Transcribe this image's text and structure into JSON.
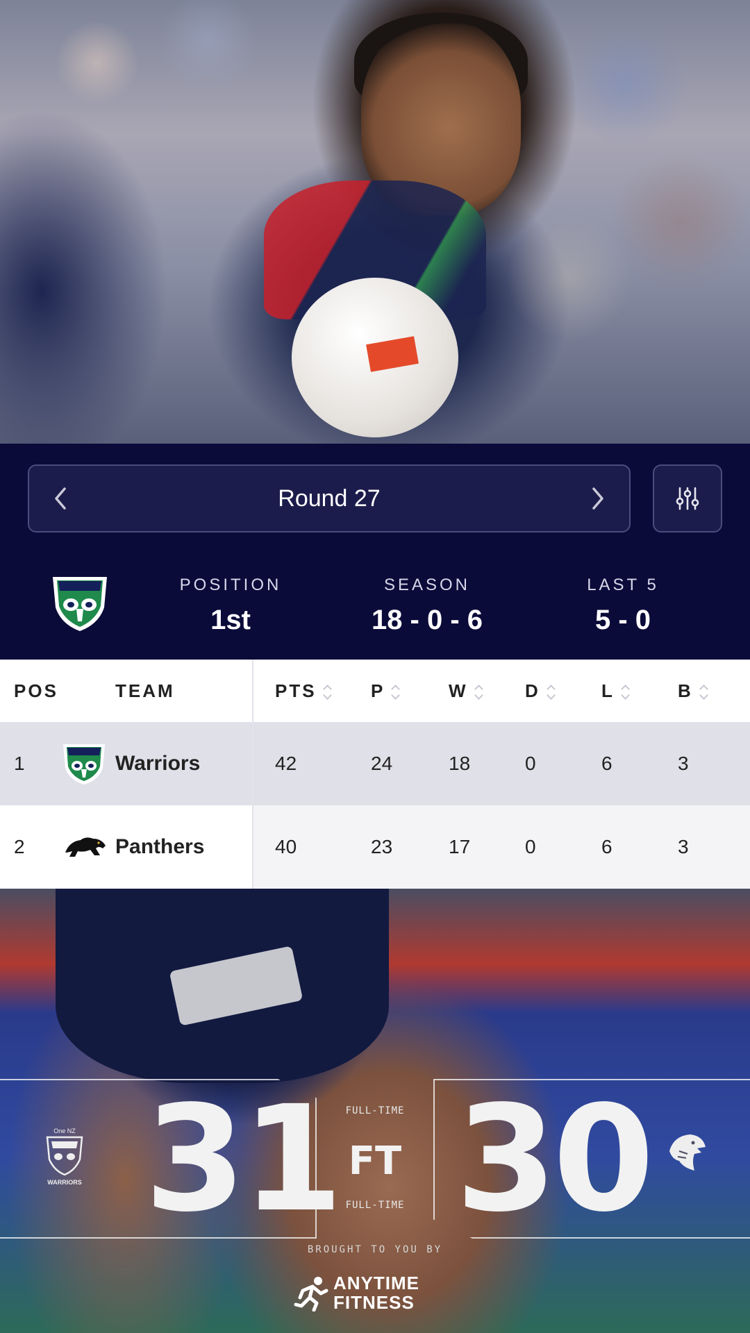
{
  "round_nav": {
    "title": "Round 27"
  },
  "summary": {
    "position": {
      "label": "POSITION",
      "value": "1st"
    },
    "season": {
      "label": "SEASON",
      "value": "18 - 0 - 6"
    },
    "last5": {
      "label": "LAST 5",
      "value": "5 - 0"
    }
  },
  "table": {
    "headers": {
      "pos": "POS",
      "team": "TEAM",
      "pts": "PTS",
      "p": "P",
      "w": "W",
      "d": "D",
      "l": "L",
      "b": "B"
    },
    "rows": [
      {
        "pos": "1",
        "team": "Warriors",
        "pts": "42",
        "p": "24",
        "w": "18",
        "d": "0",
        "l": "6",
        "b": "3"
      },
      {
        "pos": "2",
        "team": "Panthers",
        "pts": "40",
        "p": "23",
        "w": "17",
        "d": "0",
        "l": "6",
        "b": "3"
      }
    ]
  },
  "result": {
    "home_score": "31",
    "away_score": "30",
    "status_small": "FULL-TIME",
    "status_big": "FT",
    "home_crest_text": {
      "top": "One NZ",
      "bottom": "WARRIORS"
    },
    "brought_by": "BROUGHT TO YOU BY",
    "sponsor_line1": "ANYTIME",
    "sponsor_line2": "FITNESS"
  },
  "colors": {
    "navy": "#0b0b3a",
    "nav_button": "#1c1c4c",
    "row_highlight": "#e0e0e8",
    "row_alt": "#f4f4f6",
    "warriors_green": "#1f8a4c"
  },
  "icons": [
    "chevron-left-icon",
    "chevron-right-icon",
    "filter-sliders-icon",
    "sort-icon",
    "warriors-logo",
    "panthers-logo",
    "eagle-logo",
    "anytime-fitness-logo"
  ]
}
